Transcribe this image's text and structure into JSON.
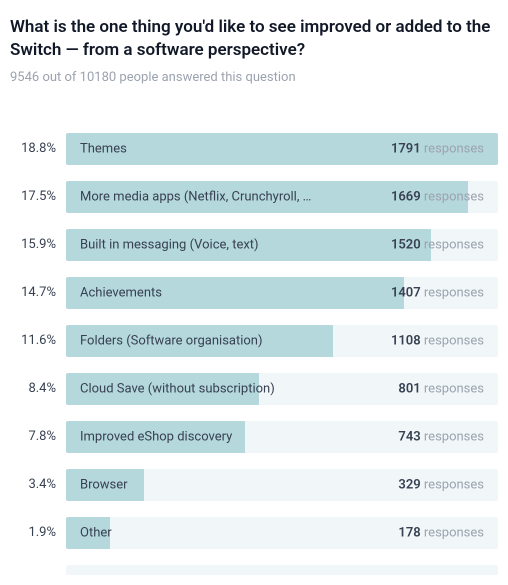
{
  "title": "What is the one thing you'd like to see improved or added to the Switch — from a software perspective?",
  "subtitle": "9546 out of 10180 people answered this question",
  "responses_word": "responses",
  "chart_data": {
    "type": "bar",
    "title": "What is the one thing you'd like to see improved or added to the Switch — from a software perspective?",
    "xlabel": "",
    "ylabel": "",
    "categories": [
      "Themes",
      "More media apps (Netflix, Crunchyroll, …",
      "Built in messaging (Voice, text)",
      "Achievements",
      "Folders (Software organisation)",
      "Cloud Save (without subscription)",
      "Improved eShop discovery",
      "Browser",
      "Other"
    ],
    "values": [
      1791,
      1669,
      1520,
      1407,
      1108,
      801,
      743,
      329,
      178
    ],
    "percentages": [
      18.8,
      17.5,
      15.9,
      14.7,
      11.6,
      8.4,
      7.8,
      3.4,
      1.9
    ],
    "total_answered": 9546,
    "total_asked": 10180
  }
}
